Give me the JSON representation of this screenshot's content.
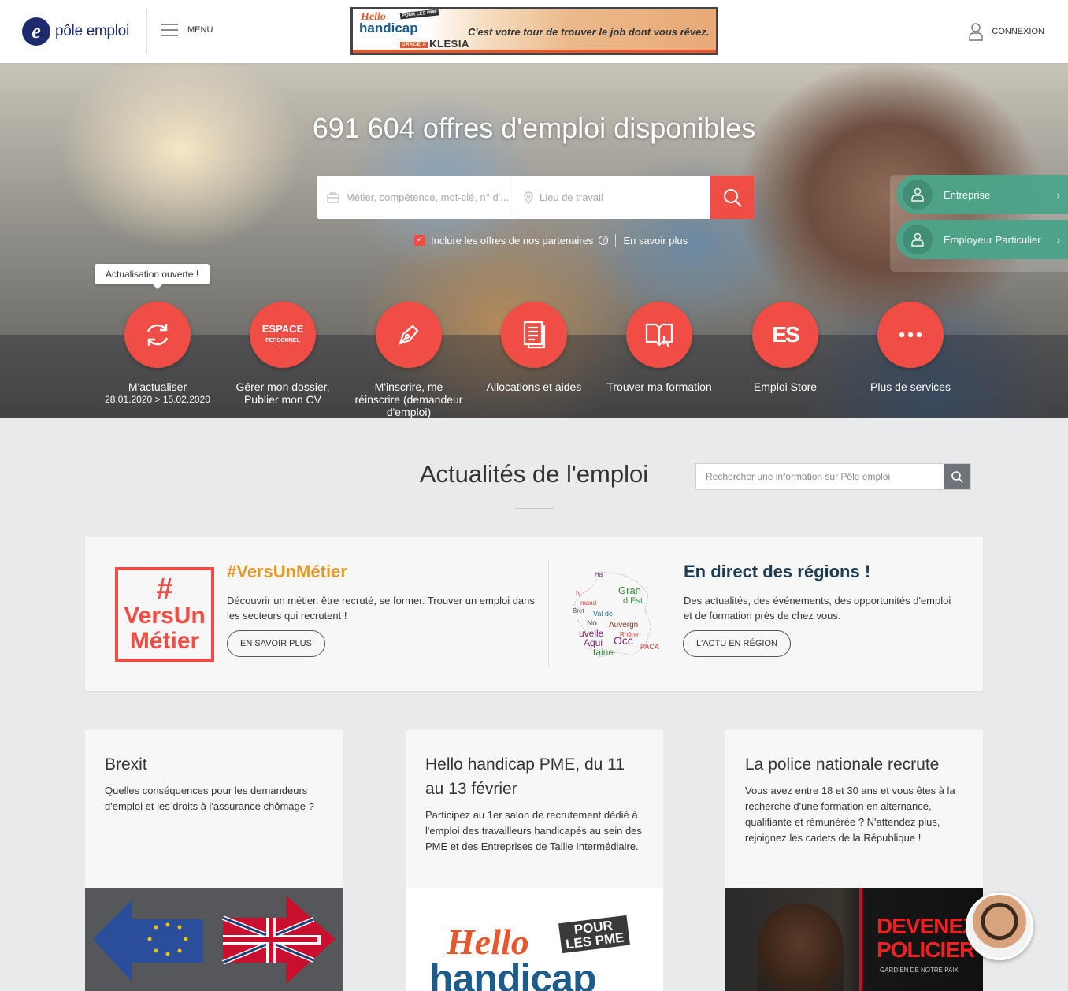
{
  "header": {
    "logo_letter": "e",
    "logo_text": "pôle emploi",
    "menu_label": "MENU",
    "banner": {
      "hello": "Hello",
      "handicap": "handicap",
      "pme_badge": "POUR LES PME",
      "sponsor_prefix": "GRÂCE À",
      "sponsor": "KLESIA",
      "tagline": "C'est votre tour de trouver le job dont vous rêvez."
    },
    "login_label": "CONNEXION"
  },
  "hero": {
    "title": "691 604 offres d'emploi disponibles",
    "search_job_placeholder": "Métier, compétence, mot-clé, n° d'...",
    "search_location_placeholder": "Lieu de travail",
    "partners_label": "Inclure les offres de nos partenaires",
    "partners_checked": true,
    "learn_more": "En savoir plus",
    "tooltip": "Actualisation ouverte !",
    "services": [
      {
        "label": "M'actualiser",
        "sub": "28.01.2020 > 15.02.2020",
        "icon": "refresh-icon"
      },
      {
        "label": "Gérer mon dossier, Publier mon CV",
        "sub": "",
        "icon": "espace-personnel-icon",
        "icon_text_1": "ESPACE",
        "icon_text_2": "PERSONNEL"
      },
      {
        "label": "M'inscrire, me réinscrire (demandeur d'emploi)",
        "sub": "",
        "icon": "pen-icon"
      },
      {
        "label": "Allocations et aides",
        "sub": "",
        "icon": "document-icon"
      },
      {
        "label": "Trouver ma formation",
        "sub": "",
        "icon": "book-icon"
      },
      {
        "label": "Emploi Store",
        "sub": "",
        "icon": "emploi-store-icon",
        "icon_text": "ES"
      },
      {
        "label": "Plus de services",
        "sub": "",
        "icon": "more-icon"
      }
    ],
    "side_links": [
      {
        "label": "Entreprise"
      },
      {
        "label": "Employeur Particulier"
      }
    ]
  },
  "news": {
    "title": "Actualités de l'emploi",
    "search_placeholder": "Rechercher une information sur Pôle emploi",
    "featured": [
      {
        "logo_hash": "#",
        "logo_line1": "VersUn",
        "logo_line2": "Métier",
        "title": "#VersUnMétier",
        "text": "Découvrir un métier, être recruté, se former. Trouver un emploi dans les secteurs qui recrutent !",
        "button": "EN SAVOIR PLUS",
        "color": "#e39a2d"
      },
      {
        "title": "En direct des régions !",
        "text": "Des actualités, des événements, des opportunités d'emploi et de formation près de chez vous.",
        "button": "L'ACTU EN RÉGION",
        "color": "#1d3b52"
      }
    ],
    "cards": [
      {
        "title": "Brexit",
        "text": "Quelles conséquences pour les demandeurs d'emploi et les droits à l'assurance chômage ?"
      },
      {
        "title": "Hello handicap PME, du 11 au 13 février",
        "text": "Participez au 1er salon de recrutement dédié à l'emploi des travailleurs handicapés au sein des PME et des Entreprises de Taille Intermédiaire.",
        "img_hello": "Hello",
        "img_handicap": "handicap",
        "img_pme_1": "POUR",
        "img_pme_2": "LES PME"
      },
      {
        "title": "La police nationale recrute",
        "text": "Vous avez entre 18 et 30 ans et vous êtes à la recherche d'une formation en alternance, qualifiante et rémunérée ? N'attendez plus, rejoignez les cadets de la République !",
        "img_text_1": "DEVENEZ",
        "img_text_2": "POLICIER",
        "img_text_3": "GARDIEN DE NOTRE PAIX"
      }
    ]
  },
  "colors": {
    "brand": "#1e2a6e",
    "accent": "#f04e45",
    "green": "#4aa58a"
  }
}
